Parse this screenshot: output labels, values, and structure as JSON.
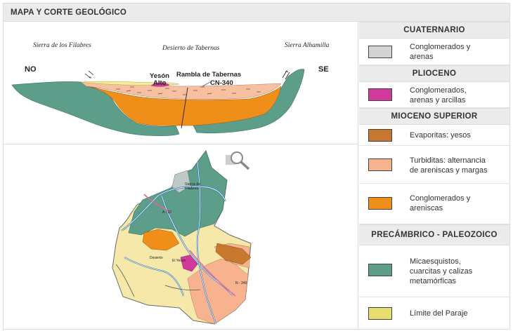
{
  "title": "MAPA Y CORTE GEOLÓGICO",
  "cross_section": {
    "labels": {
      "sierra_filabres": "Sierra de los Filabres",
      "desierto": "Desierto de Tabernas",
      "sierra_alhamilla": "Sierra Alhamilla",
      "no": "NO",
      "se": "SE",
      "yeson": "Yesón",
      "alto": "Alto",
      "rambla": "Rambla de Tabernas",
      "cn": "CN-340"
    }
  },
  "map": {
    "zoom_icon": "magnifier-icon",
    "labels": {
      "sierra": "Sierra de",
      "filabres": "Filabres",
      "a92": "A - 92",
      "desierto": "Desierto",
      "el_yeson": "El Yesón",
      "n340": "N - 340"
    }
  },
  "legend": {
    "groups": [
      {
        "heading": "CUATERNARIO",
        "items": [
          {
            "color": "#d3d3d3",
            "text_lines": [
              "Conglomerados y",
              "arenas"
            ]
          }
        ]
      },
      {
        "heading": "PLIOCENO",
        "items": [
          {
            "color": "#d3399a",
            "text_lines": [
              "Conglomerados,",
              "arenas y arcillas"
            ]
          }
        ]
      },
      {
        "heading": "MIOCENO SUPERIOR",
        "items": [
          {
            "color": "#c8782e",
            "text_lines": [
              "Evaporitas: yesos"
            ]
          },
          {
            "color": "#f7b390",
            "text_lines": [
              "Turbiditas: alternancia",
              "de areniscas y margas"
            ]
          },
          {
            "color": "#ef8f1a",
            "text_lines": [
              "Conglomerados y",
              "areniscas"
            ]
          }
        ]
      },
      {
        "heading": "PRECÁMBRICO - PALEOZOICO",
        "items": [
          {
            "color": "#5d9e8a",
            "text_lines": [
              "Micaesquistos,",
              "cuarcitas y calizas",
              "metamórficas"
            ]
          },
          {
            "color": "#e6df70",
            "text_lines": [
              "Límite del Paraje"
            ]
          }
        ]
      }
    ]
  }
}
